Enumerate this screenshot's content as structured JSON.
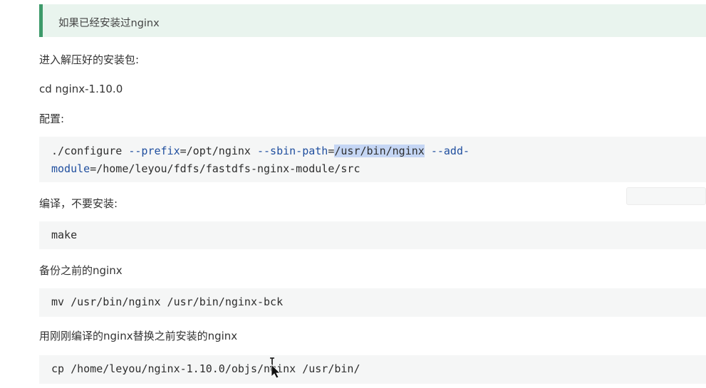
{
  "tip": {
    "text": "如果已经安装过nginx"
  },
  "step1": {
    "label": "进入解压好的安装包:",
    "command": "cd nginx-1.10.0"
  },
  "step2": {
    "label": "配置:",
    "line1": {
      "part1": "./configure ",
      "opt1": "--prefix",
      "part2": "=/opt/nginx ",
      "opt2": "--sbin-path",
      "part3": "=",
      "selected": "/usr/bin/nginx",
      "part4": " ",
      "opt3": "--add-"
    },
    "line2": {
      "opt": "module",
      "part": "=/home/leyou/fdfs/fastdfs-nginx-module/src"
    }
  },
  "step3": {
    "label": "编译，不要安装:",
    "command": "make"
  },
  "step4": {
    "label": "备份之前的nginx",
    "command": "mv /usr/bin/nginx /usr/bin/nginx-bck"
  },
  "step5": {
    "label": "用刚刚编译的nginx替换之前安装的nginx",
    "command_before": "cp /home/leyou/nginx-1.10.0/",
    "command_after": "objs/nginx /usr/bin/"
  },
  "icons": {
    "cursor": "text-cursor-arrow-icon"
  },
  "colors": {
    "tip_bg": "#e9f4ee",
    "tip_border": "#3d9a6a",
    "code_bg": "#f5f6f6",
    "option_text": "#1f4e9e",
    "selection": "#c5d6f4"
  }
}
